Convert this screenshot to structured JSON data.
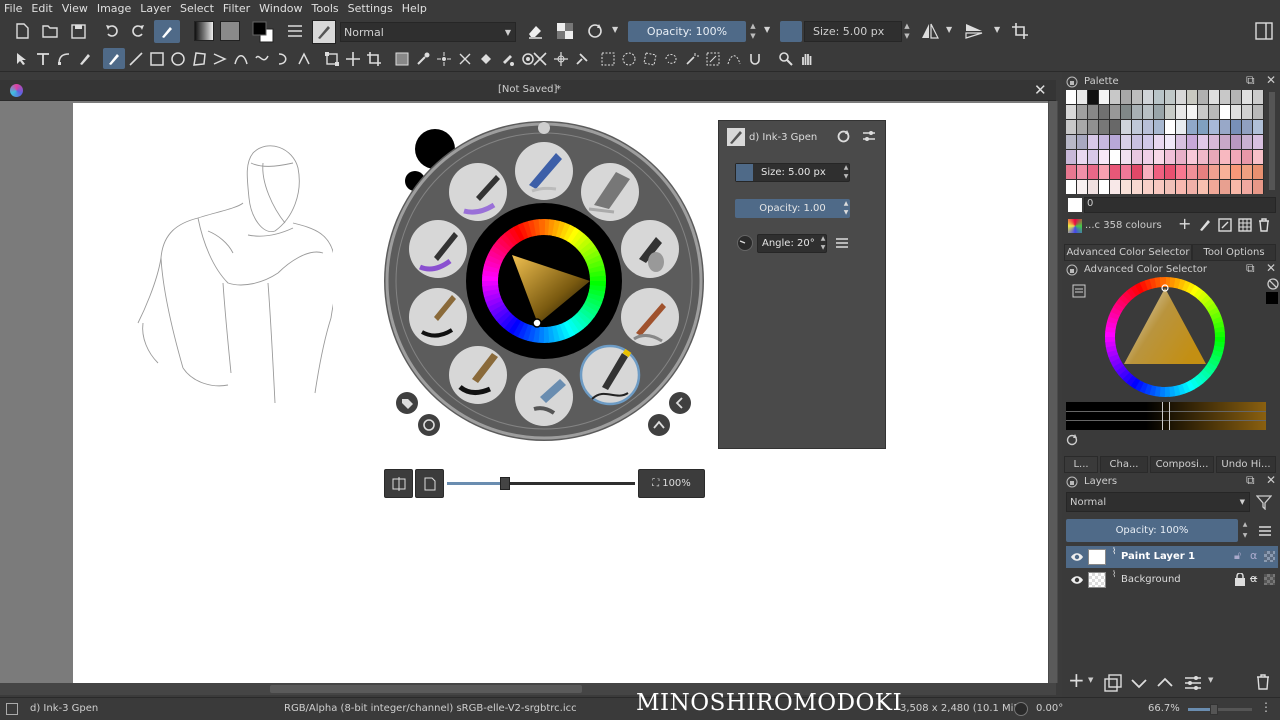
{
  "menubar": {
    "items": [
      "File",
      "Edit",
      "View",
      "Image",
      "Layer",
      "Select",
      "Filter",
      "Window",
      "Tools",
      "Settings",
      "Help"
    ]
  },
  "toolbar": {
    "blend_mode": "Normal",
    "opacity_label": "Opacity: 100%",
    "size_label": "Size: 5.00 px"
  },
  "document": {
    "title": "[Not Saved]",
    "modified_mark": "*"
  },
  "brush_editor": {
    "preset_name": "d) Ink-3 Gpen",
    "size_label": "Size: 5.00 px",
    "opacity_label": "Opacity: 1.00",
    "angle_label": "Angle: 20°"
  },
  "popup_palette": {
    "zoom_label": "100%"
  },
  "palette": {
    "title": "Palette",
    "entry_name": "0",
    "colours_label": "...c 358 colours"
  },
  "color_selector": {
    "tab_advanced": "Advanced Color Selector",
    "tab_tool_options": "Tool Options",
    "title": "Advanced Color Selector"
  },
  "bottom_tabs": [
    "L...",
    "Cha...",
    "Composi...",
    "Undo Hi..."
  ],
  "layers": {
    "title": "Layers",
    "blend_mode": "Normal",
    "opacity_label": "Opacity:  100%",
    "items": [
      {
        "name": "Paint Layer 1",
        "active": true
      },
      {
        "name": "Background",
        "active": false
      }
    ]
  },
  "statusbar": {
    "brush": "d) Ink-3 Gpen",
    "color_profile": "RGB/Alpha (8-bit integer/channel)  sRGB-elle-V2-srgbtrc.icc",
    "image_size": "3,508 x 2,480 (10.1 MiB)",
    "rotation": "0.00°",
    "zoom": "66.7%"
  },
  "watermark": "MINOSHIROMODOKI",
  "colors": {
    "accent": "#4f6a88",
    "bg": "#3a3a3a",
    "fg_color": "#000000",
    "bg_color": "#ffffff"
  }
}
